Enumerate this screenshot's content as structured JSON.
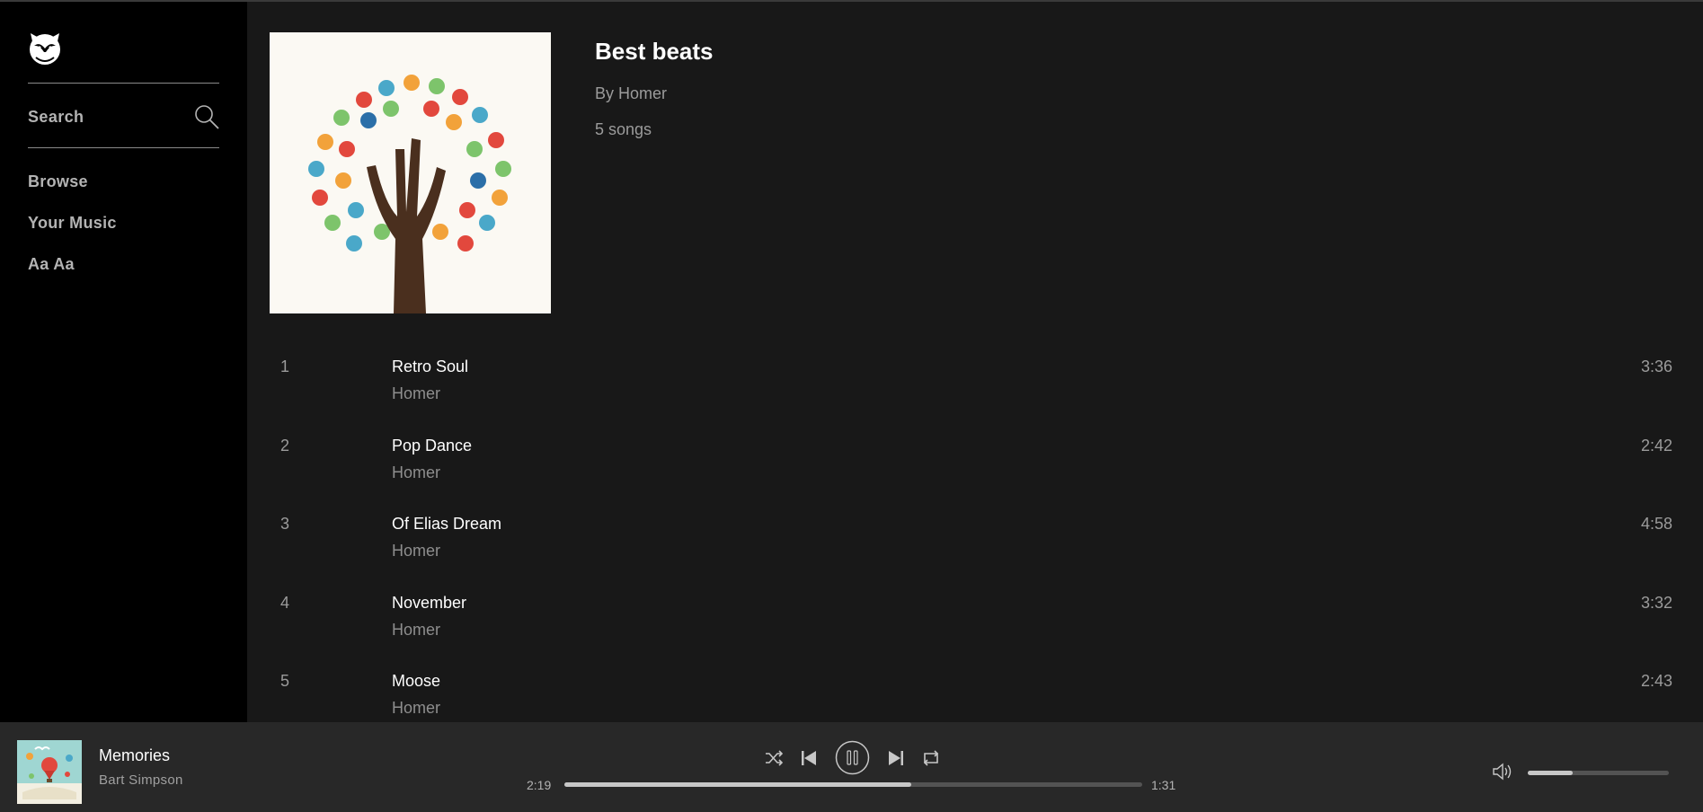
{
  "sidebar": {
    "search_label": "Search",
    "nav": [
      {
        "label": "Browse"
      },
      {
        "label": "Your Music"
      },
      {
        "label": "Aa Aa"
      }
    ]
  },
  "playlist": {
    "title": "Best beats",
    "owner": "By Homer",
    "song_count": "5 songs",
    "tracks": [
      {
        "number": "1",
        "title": "Retro Soul",
        "artist": "Homer",
        "duration": "3:36"
      },
      {
        "number": "2",
        "title": "Pop Dance",
        "artist": "Homer",
        "duration": "2:42"
      },
      {
        "number": "3",
        "title": "Of Elias Dream",
        "artist": "Homer",
        "duration": "4:58"
      },
      {
        "number": "4",
        "title": "November",
        "artist": "Homer",
        "duration": "3:32"
      },
      {
        "number": "5",
        "title": "Moose",
        "artist": "Homer",
        "duration": "2:43"
      }
    ]
  },
  "player": {
    "now_playing_title": "Memories",
    "now_playing_artist": "Bart Simpson",
    "elapsed": "2:19",
    "remaining": "1:31",
    "progress_fraction": 0.6,
    "volume_fraction": 0.32
  },
  "colors": {
    "sidebar_bg": "#000000",
    "main_bg": "#181818",
    "player_bg": "#282828",
    "text_primary": "#ffffff",
    "text_secondary": "#9b9b9b"
  },
  "icons": {
    "logo": "fox-logo-icon",
    "search": "search-icon",
    "shuffle": "shuffle-icon",
    "previous": "previous-icon",
    "pause": "pause-icon",
    "next": "next-icon",
    "repeat": "repeat-icon",
    "volume": "volume-icon"
  }
}
